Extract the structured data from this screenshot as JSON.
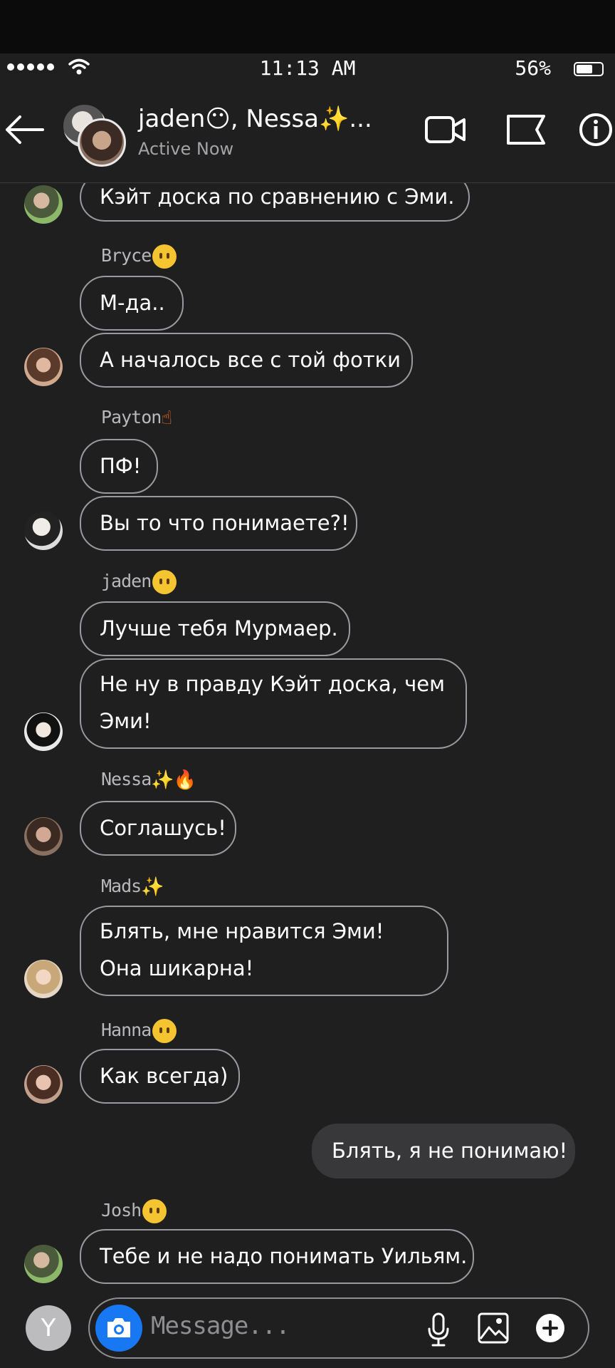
{
  "status_bar": {
    "time": "11:13 AM",
    "battery": "56%"
  },
  "header": {
    "title": "jaden😶, Nessa✨...",
    "subtitle": "Active Now"
  },
  "messages": [
    {
      "text": "Кэйт доска по сравнению с Эми."
    },
    {
      "sender": "Bryce🙂",
      "text": "М-да.."
    },
    {
      "text": "А началось все с той фотки"
    },
    {
      "sender": "Payton🖕",
      "text": "ПФ!"
    },
    {
      "text": "Вы то что понимаете?!"
    },
    {
      "sender": "jaden😶",
      "text": "Лучше тебя Мурмаер."
    },
    {
      "text": "Не ну в правду Кэйт доска, чем Эми!"
    },
    {
      "sender": "Nessa✨🔥",
      "text": "Соглашусь!"
    },
    {
      "sender": "Mads✨",
      "text": "Блять, мне нравится Эми! Она шикарна!"
    },
    {
      "sender": "Hanna😩",
      "text": "Как всегда)"
    },
    {
      "text": "Блять, я не понимаю!"
    },
    {
      "sender": "Josh😶",
      "text": "Тебе и не надо понимать Уильям."
    }
  ],
  "composer": {
    "avatar_letter": "Y",
    "placeholder": "Message..."
  }
}
